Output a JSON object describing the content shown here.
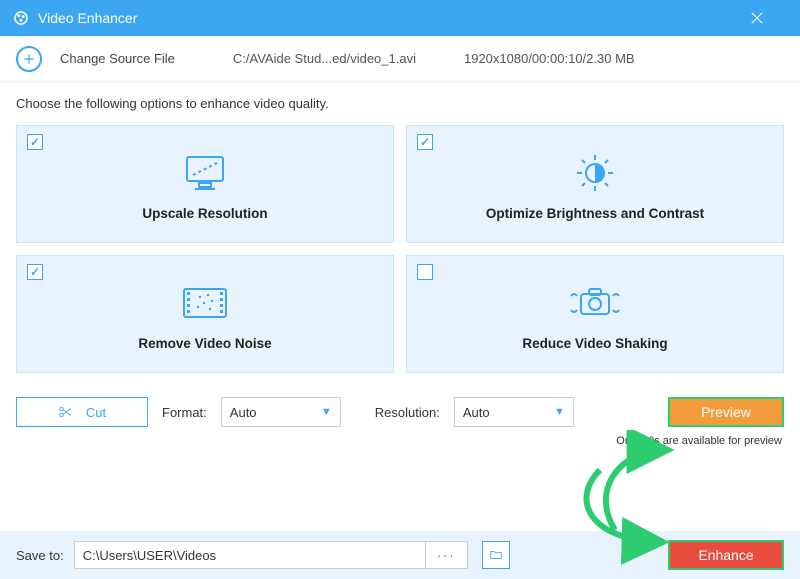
{
  "titlebar": {
    "title": "Video Enhancer"
  },
  "source": {
    "change_label": "Change Source File",
    "path": "C:/AVAide Stud...ed/video_1.avi",
    "meta": "1920x1080/00:00:10/2.30 MB"
  },
  "instruction": "Choose the following options to enhance video quality.",
  "cards": [
    {
      "label": "Upscale Resolution",
      "checked": true
    },
    {
      "label": "Optimize Brightness and Contrast",
      "checked": true
    },
    {
      "label": "Remove Video Noise",
      "checked": true
    },
    {
      "label": "Reduce Video Shaking",
      "checked": false
    }
  ],
  "controls": {
    "cut_label": "Cut",
    "format_label": "Format:",
    "format_value": "Auto",
    "resolution_label": "Resolution:",
    "resolution_value": "Auto",
    "preview_label": "Preview",
    "preview_note": "Only 10s are available for preview"
  },
  "save": {
    "label": "Save to:",
    "path": "C:\\Users\\USER\\Videos",
    "enhance_label": "Enhance"
  }
}
